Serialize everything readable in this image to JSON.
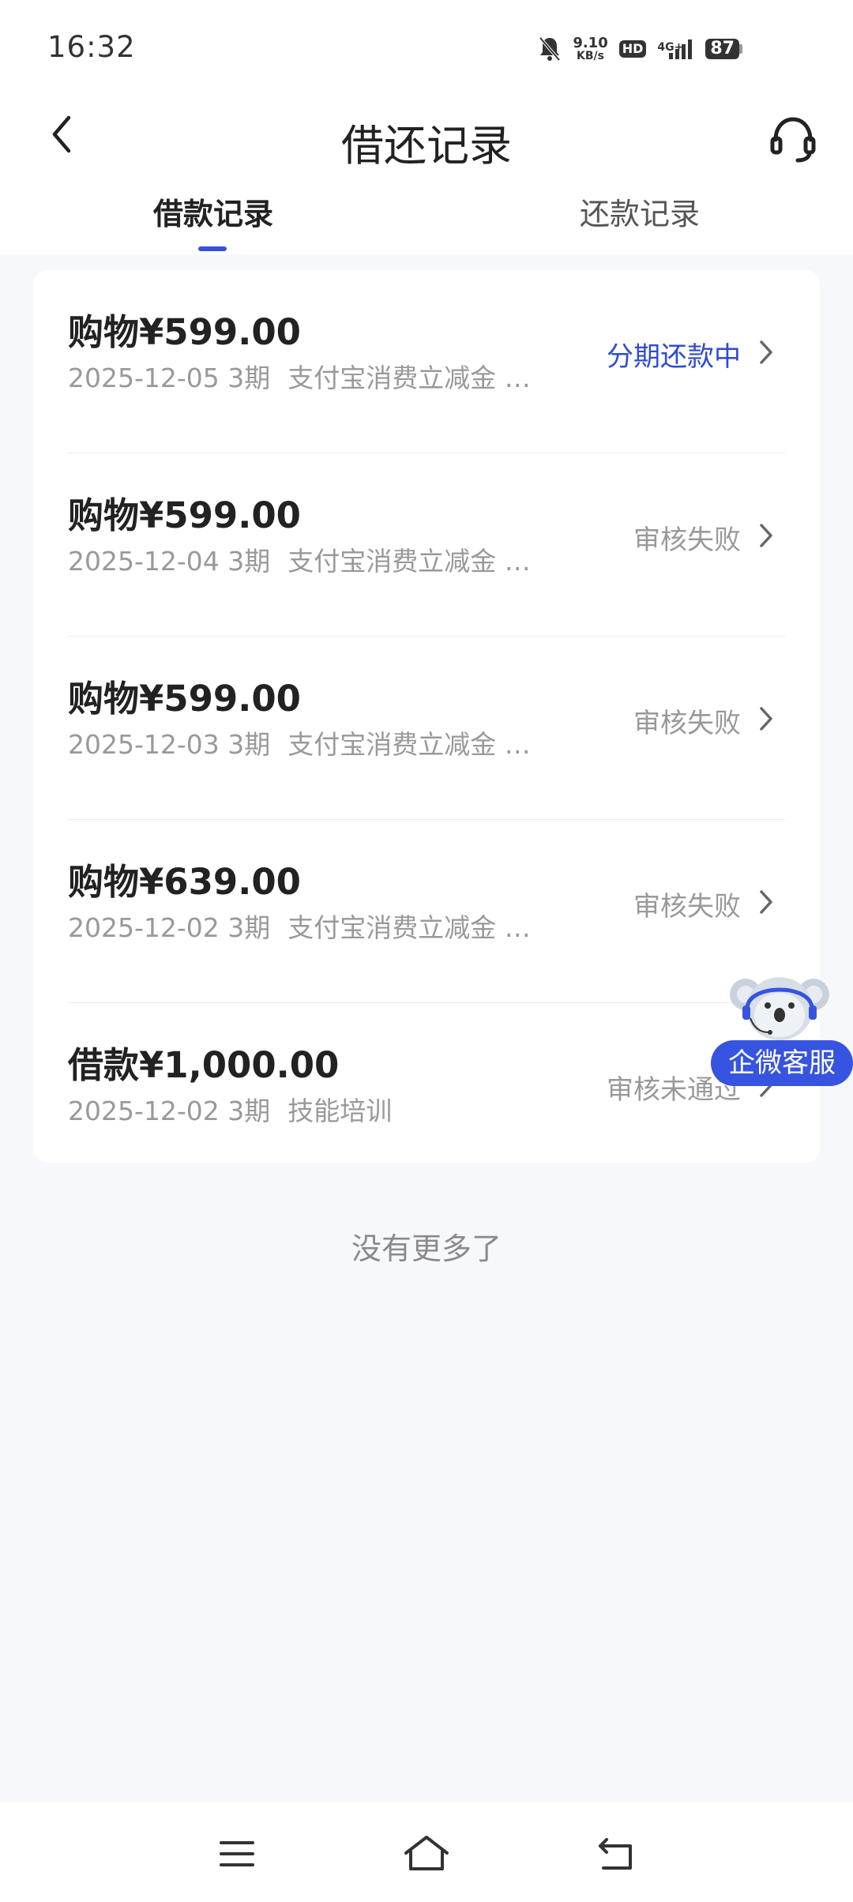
{
  "status_bar": {
    "time": "16:32",
    "net_speed_value": "9.10",
    "net_speed_unit": "KB/s",
    "hd_label": "HD",
    "network_label": "4G+",
    "battery": "87"
  },
  "header": {
    "title": "借还记录"
  },
  "tabs": [
    {
      "label": "借款记录",
      "active": true
    },
    {
      "label": "还款记录",
      "active": false
    }
  ],
  "records": [
    {
      "title": "购物¥599.00",
      "date": "2025-12-05",
      "periods": "3期",
      "desc": "支付宝消费立减金 …",
      "status": "分期还款中",
      "status_color": "#2f4bd1"
    },
    {
      "title": "购物¥599.00",
      "date": "2025-12-04",
      "periods": "3期",
      "desc": "支付宝消费立减金 …",
      "status": "审核失败",
      "status_color": "#999999"
    },
    {
      "title": "购物¥599.00",
      "date": "2025-12-03",
      "periods": "3期",
      "desc": "支付宝消费立减金 …",
      "status": "审核失败",
      "status_color": "#999999"
    },
    {
      "title": "购物¥639.00",
      "date": "2025-12-02",
      "periods": "3期",
      "desc": "支付宝消费立减金 …",
      "status": "审核失败",
      "status_color": "#999999"
    },
    {
      "title": "借款¥1,000.00",
      "date": "2025-12-02",
      "periods": "3期",
      "desc": "技能培训",
      "status": "审核未通过",
      "status_color": "#999999"
    }
  ],
  "footer_text": "没有更多了",
  "floating_button": {
    "label": "企微客服"
  },
  "colors": {
    "accent": "#3654e0",
    "background": "#f7f8fc"
  }
}
